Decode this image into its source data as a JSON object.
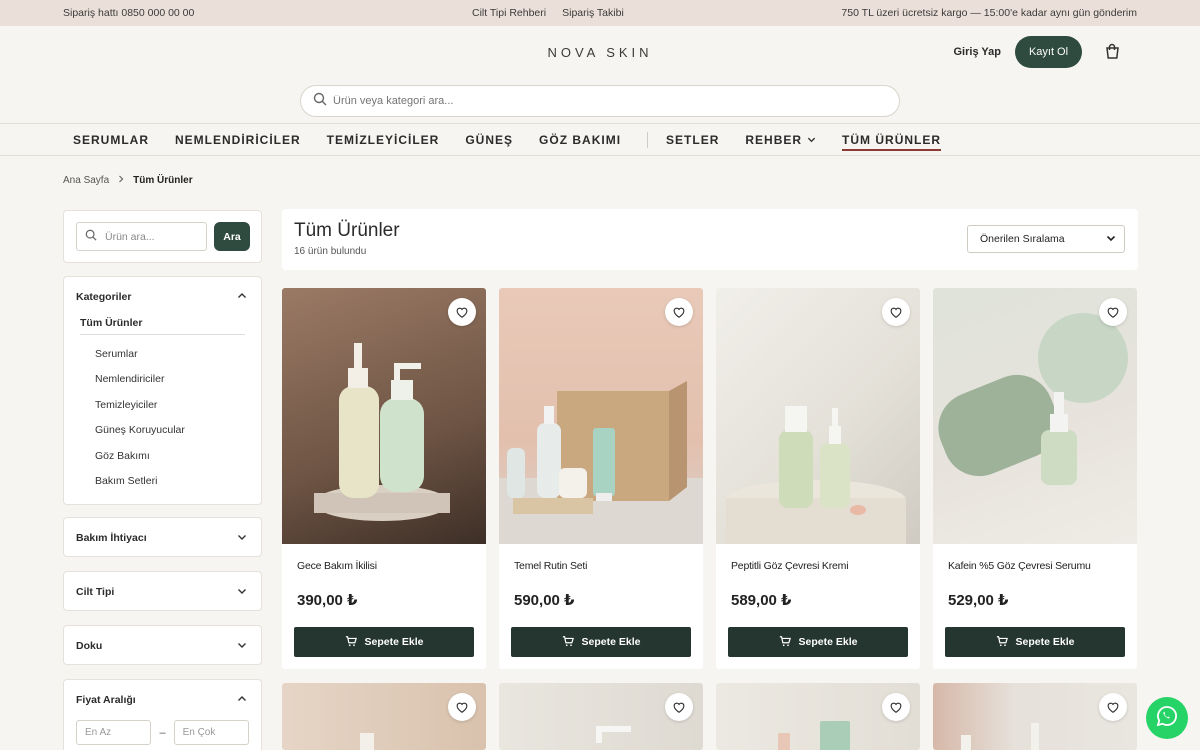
{
  "topbar": {
    "phone": "Sipariş hattı 0850 000 00 00",
    "link1": "Cilt Tipi Rehberi",
    "link2": "Sipariş Takibi",
    "promo": "750 TL üzeri ücretsiz kargo — 15:00'e kadar aynı gün gönderim"
  },
  "header": {
    "logo": "NOVA SKIN",
    "login": "Giriş Yap",
    "signup": "Kayıt Ol"
  },
  "search": {
    "placeholder": "Ürün veya kategori ara..."
  },
  "nav": [
    "SERUMLAR",
    "NEMLENDİRİCİLER",
    "TEMİZLEYİCİLER",
    "GÜNEŞ",
    "GÖZ BAKIMI",
    "SETLER",
    "REHBER",
    "TÜM ÜRÜNLER"
  ],
  "breadcrumb": {
    "home": "Ana Sayfa",
    "current": "Tüm Ürünler"
  },
  "sidebar": {
    "search_placeholder": "Ürün ara...",
    "search_button": "Ara",
    "categories_title": "Kategoriler",
    "all": "Tüm Ürünler",
    "items": [
      "Serumlar",
      "Nemlendiriciler",
      "Temizleyiciler",
      "Güneş Koruyucular",
      "Göz Bakımı",
      "Bakım Setleri"
    ],
    "need": "Bakım İhtiyacı",
    "skin": "Cilt Tipi",
    "texture": "Doku",
    "price": "Fiyat Aralığı",
    "min": "En Az",
    "max": "En Çok",
    "dash": "–"
  },
  "main": {
    "title": "Tüm Ürünler",
    "count": "16 ürün bulundu",
    "sort": "Önerilen Sıralama"
  },
  "products": [
    {
      "name": "Gece Bakım İkilisi",
      "price": "390,00 ₺",
      "button": "Sepete Ekle"
    },
    {
      "name": "Temel Rutin Seti",
      "price": "590,00 ₺",
      "button": "Sepete Ekle"
    },
    {
      "name": "Peptitli Göz Çevresi Kremi",
      "price": "589,00 ₺",
      "button": "Sepete Ekle"
    },
    {
      "name": "Kafein %5 Göz Çevresi Serumu",
      "price": "529,00 ₺",
      "button": "Sepete Ekle"
    }
  ],
  "colors": {
    "accent": "#2f4a3e",
    "button_dark": "#25352f",
    "active_underline": "#8a3a30",
    "topbar": "#ebe0d9",
    "whatsapp": "#25d366"
  }
}
